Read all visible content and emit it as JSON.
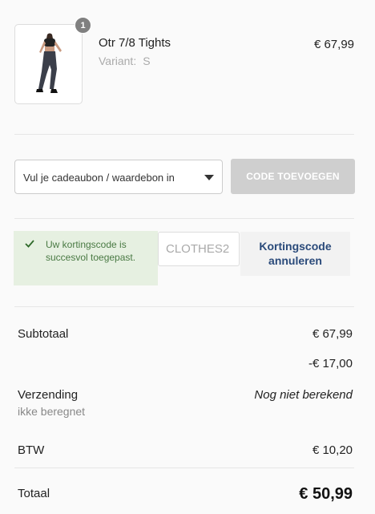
{
  "cart": {
    "item": {
      "quantity": "1",
      "name": "Otr 7/8 Tights",
      "variant_label": "Variant:",
      "variant_value": "S",
      "price": "€ 67,99"
    }
  },
  "gift": {
    "select_label": "Vul je cadeaubon / waardebon in",
    "apply_button": "CODE TOEVOEGEN"
  },
  "discount": {
    "success_message": "Uw kortingscode is succesvol toegepast.",
    "code_value": "CLOTHES2",
    "cancel_button": "Kortingscode annuleren"
  },
  "summary": {
    "subtotal_label": "Subtotaal",
    "subtotal_value": "€ 67,99",
    "discount_value": "-€ 17,00",
    "shipping_label": "Verzending",
    "shipping_note": "ikke beregnet",
    "shipping_value": "Nog niet berekend",
    "vat_label": "BTW",
    "vat_value": "€ 10,20",
    "total_label": "Totaal",
    "total_value": "€ 50,99"
  },
  "colors": {
    "success_bg": "#e6f0e1",
    "success_text": "#4a7a44",
    "link_blue": "#2a4a7a",
    "disabled_button": "#cfcfcf"
  }
}
